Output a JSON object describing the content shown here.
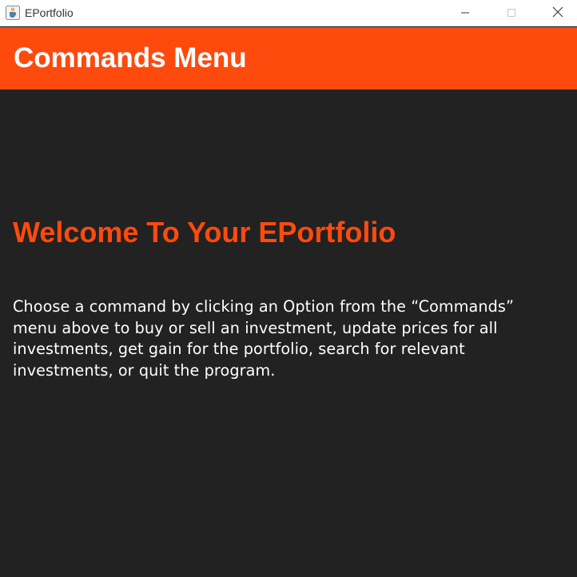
{
  "window": {
    "title": "EPortfolio",
    "app_icon": "java-cup-icon",
    "controls": {
      "minimize_icon": "minimize-icon",
      "maximize_icon": "maximize-icon",
      "close_icon": "close-icon"
    }
  },
  "header": {
    "title": "Commands Menu"
  },
  "main": {
    "welcome": "Welcome To Your EPortfolio",
    "description": "Choose a command by clicking an Option from the “Commands” menu above to buy or sell an investment, update prices for all investments, get gain for the portfolio, search for relevant investments, or quit the program."
  },
  "colors": {
    "accent": "#ff4a0d",
    "background": "#222222",
    "text": "#ffffff"
  }
}
